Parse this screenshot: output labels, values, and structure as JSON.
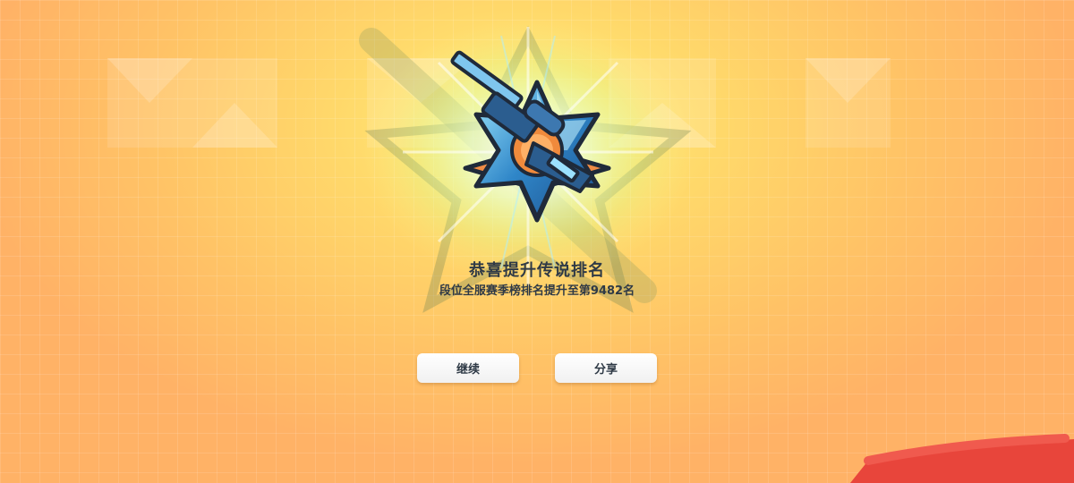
{
  "promotion": {
    "title": "恭喜提升传说排名",
    "subtitle": "段位全服赛季榜排名提升至第9482名"
  },
  "actions": {
    "continue_label": "继续",
    "share_label": "分享"
  },
  "emblem": {
    "icon": "legend-rank-sniper-star-icon"
  },
  "colors": {
    "background_center": "#fff07a",
    "background_edge": "#ffb266",
    "text": "#2f3a46",
    "star_blue": "#2f86c8",
    "badge_orange": "#f08a3c",
    "redaction": "#e8453b"
  }
}
